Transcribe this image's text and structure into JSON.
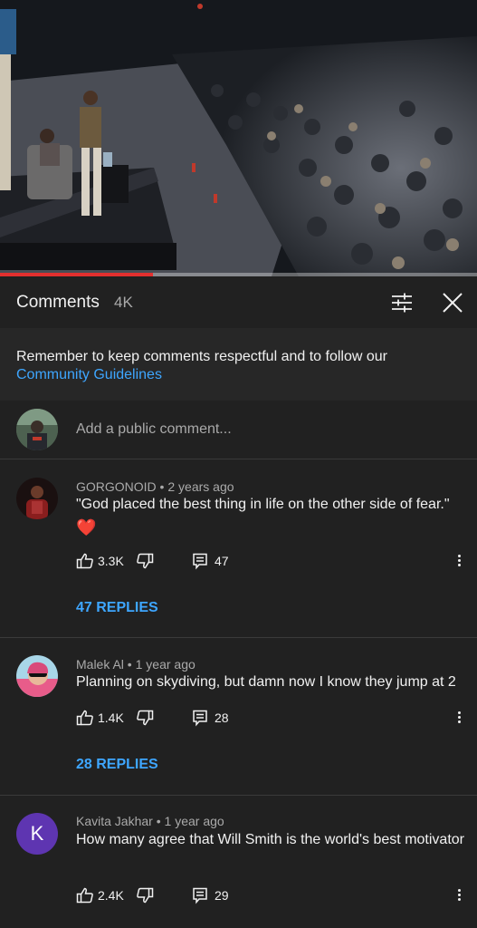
{
  "video": {
    "progress_fraction": 0.32
  },
  "panel": {
    "title": "Comments",
    "count": "4K",
    "filter_icon": "sliders-icon",
    "close_icon": "close-icon"
  },
  "notice": {
    "text": "Remember to keep comments respectful and to follow our",
    "link": "Community Guidelines"
  },
  "add_comment": {
    "placeholder": "Add a public comment..."
  },
  "comments": [
    {
      "author": "GORGONOID",
      "time": "2 years ago",
      "text": "\"God placed the best thing in life on the other side of fear.\"",
      "emoji": "❤️",
      "likes": "3.3K",
      "reply_count": "47",
      "replies_label": "47 REPLIES"
    },
    {
      "author": "Malek Al",
      "time": "1 year ago",
      "text": "Planning on skydiving, but damn now I know they jump at 2",
      "likes": "1.4K",
      "reply_count": "28",
      "replies_label": "28 REPLIES"
    },
    {
      "author": "Kavita Jakhar",
      "time": "1 year ago",
      "text": "How many agree that Will Smith is the world's best motivator",
      "avatar_letter": "K",
      "likes": "2.4K",
      "reply_count": "29"
    }
  ],
  "colors": {
    "background": "#212121",
    "accent_link": "#3ea6ff",
    "progress": "#e3302f",
    "avatar_k": "#5e35b1"
  }
}
